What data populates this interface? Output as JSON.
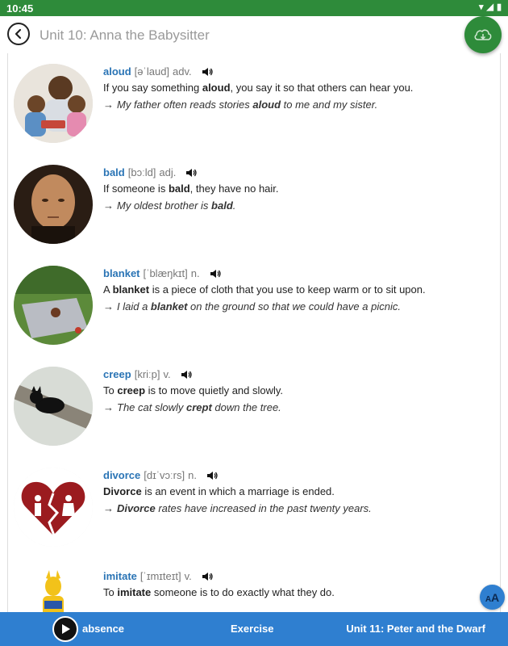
{
  "status": {
    "time": "10:45"
  },
  "header": {
    "title": "Unit 10: Anna the Babysitter",
    "back_icon": "back-arrow-icon",
    "download_icon": "cloud-download-icon"
  },
  "entries": [
    {
      "word": "aloud",
      "pron": "[əˈlaud]",
      "pos": "adv.",
      "image": "family-reading-photo",
      "def_before": "If you say something ",
      "def_bold": "aloud",
      "def_after": ", you say it so that others can hear you.",
      "ex_before": "My father often reads stories ",
      "ex_bold": "aloud",
      "ex_after": " to me and my sister."
    },
    {
      "word": "bald",
      "pron": "[bɔːld]",
      "pos": "adj.",
      "image": "bald-man-photo",
      "def_before": "If someone is ",
      "def_bold": "bald",
      "def_after": ", they have no hair.",
      "ex_before": "My oldest brother is ",
      "ex_bold": "bald",
      "ex_after": "."
    },
    {
      "word": "blanket",
      "pron": "[ˈblæŋkɪt]",
      "pos": "n.",
      "image": "picnic-blanket-photo",
      "def_before": "A ",
      "def_bold": "blanket",
      "def_after": " is a piece of cloth that you use to keep warm or to sit upon.",
      "ex_before": "I laid a ",
      "ex_bold": "blanket",
      "ex_after": " on the ground so that we could have a picnic."
    },
    {
      "word": "creep",
      "pron": "[kriːp]",
      "pos": "v.",
      "image": "black-cat-on-tree-photo",
      "def_before": "To ",
      "def_bold": "creep",
      "def_after": " is to move quietly and slowly.",
      "ex_before": "The cat slowly ",
      "ex_bold": "crept",
      "ex_after": " down the tree."
    },
    {
      "word": "divorce",
      "pron": "[dɪˈvɔːrs]",
      "pos": "n.",
      "image": "broken-heart-icon",
      "def_before": "",
      "def_bold": "Divorce",
      "def_after": " is an event in which a marriage is ended.",
      "ex_before": "",
      "ex_bold": "Divorce",
      "ex_after": " rates have increased in the past twenty years."
    },
    {
      "word": "imitate",
      "pron": "[ˈɪmɪteɪt]",
      "pos": "v.",
      "image": "superhero-costume-photo",
      "def_before": "To ",
      "def_bold": "imitate",
      "def_after": " someone is to do exactly what they do.",
      "ex_before": "",
      "ex_bold": "",
      "ex_after": ""
    }
  ],
  "bottom": {
    "current_word": "absence",
    "exercise": "Exercise",
    "next_unit": "Unit 11: Peter and the Dwarf"
  },
  "font_button": {
    "big": "A",
    "small": "A"
  },
  "colors": {
    "status_green": "#2e8b3a",
    "word_blue": "#2a74b5",
    "bottom_blue": "#2f7fd0"
  }
}
